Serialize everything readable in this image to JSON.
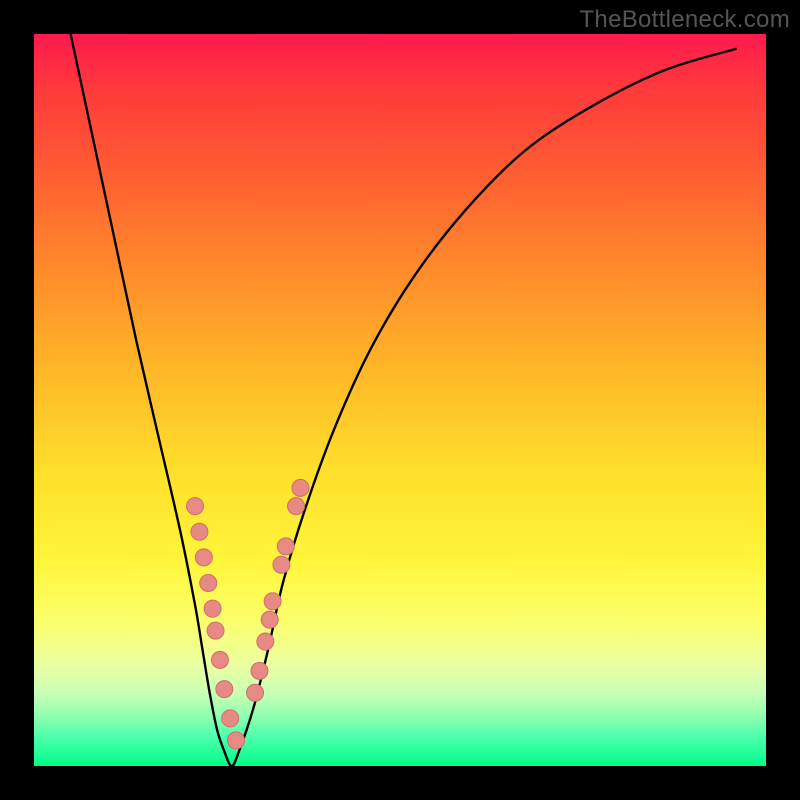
{
  "watermark": "TheBottleneck.com",
  "colors": {
    "frame": "#000000",
    "curve": "#000000",
    "dot_fill": "#e88a84",
    "dot_stroke": "#cf6f6a"
  },
  "chart_data": {
    "type": "line",
    "title": "",
    "xlabel": "",
    "ylabel": "",
    "xlim": [
      0,
      100
    ],
    "ylim": [
      0,
      100
    ],
    "grid": false,
    "series": [
      {
        "name": "bottleneck-curve",
        "x": [
          5,
          8,
          11,
          14,
          17,
          20,
          22,
          23,
          24,
          25,
          26,
          27,
          28,
          30,
          32,
          34,
          37,
          41,
          46,
          52,
          59,
          67,
          76,
          86,
          96
        ],
        "y": [
          100,
          86,
          72,
          58,
          45,
          32,
          22,
          16,
          10,
          5,
          2,
          0,
          2,
          8,
          16,
          25,
          35,
          46,
          57,
          67,
          76,
          84,
          90,
          95,
          98
        ]
      }
    ],
    "dots": {
      "name": "highlight-dots",
      "x_percent": [
        22.0,
        22.6,
        23.2,
        23.8,
        24.4,
        24.8,
        25.4,
        26.0,
        26.8,
        27.6,
        30.2,
        30.8,
        31.6,
        32.2,
        32.6,
        33.8,
        34.4,
        35.8,
        36.4
      ],
      "y_percent": [
        35.5,
        32.0,
        28.5,
        25.0,
        21.5,
        18.5,
        14.5,
        10.5,
        6.5,
        3.5,
        10.0,
        13.0,
        17.0,
        20.0,
        22.5,
        27.5,
        30.0,
        35.5,
        38.0
      ]
    }
  }
}
